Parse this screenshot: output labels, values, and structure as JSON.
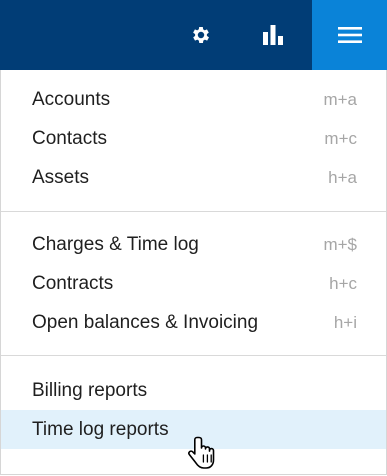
{
  "topbar": {
    "settings_icon": "gear-icon",
    "reports_icon": "bar-chart-icon",
    "menu_icon": "hamburger-menu-icon",
    "colors": {
      "background": "#013d76",
      "active": "#0a83d8"
    }
  },
  "menu": {
    "groups": [
      [
        {
          "label": "Accounts",
          "shortcut": "m+a"
        },
        {
          "label": "Contacts",
          "shortcut": "m+c"
        },
        {
          "label": "Assets",
          "shortcut": "h+a"
        }
      ],
      [
        {
          "label": "Charges & Time log",
          "shortcut": "m+$"
        },
        {
          "label": "Contracts",
          "shortcut": "h+c"
        },
        {
          "label": "Open balances & Invoicing",
          "shortcut": "h+i"
        }
      ],
      [
        {
          "label": "Billing reports",
          "shortcut": ""
        },
        {
          "label": "Time log reports",
          "shortcut": ""
        }
      ]
    ],
    "highlight_color": "#e1f1fb"
  }
}
